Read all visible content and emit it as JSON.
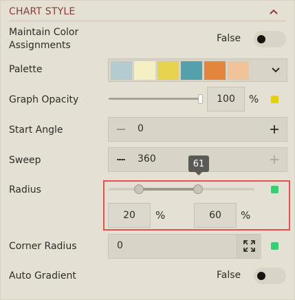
{
  "header": {
    "title": "CHART STYLE",
    "collapse_icon": "chevron-up-icon"
  },
  "maintain_colors": {
    "label": "Maintain Color Assignments",
    "label_line1": "Maintain Color",
    "label_line2": "Assignments",
    "value_text": "False",
    "checked": false
  },
  "palette": {
    "label": "Palette",
    "swatches": [
      "#b4cbd0",
      "#f5efc4",
      "#e7d34d",
      "#55a0ad",
      "#e3853d",
      "#f1c39a"
    ],
    "dropdown_icon": "chevron-down-icon"
  },
  "graph_opacity": {
    "label": "Graph Opacity",
    "value": "100",
    "unit": "%",
    "slider_fraction": 1.0,
    "color": "#e6cf0f"
  },
  "start_angle": {
    "label": "Start Angle",
    "value": "0",
    "minus_icon": "minus-icon",
    "plus_icon": "plus-icon"
  },
  "sweep": {
    "label": "Sweep",
    "value": "360",
    "minus_icon": "minus-icon",
    "plus_icon": "plus-icon"
  },
  "radius": {
    "label": "Radius",
    "tooltip": "61",
    "min_value": "20",
    "max_value": "60",
    "unit": "%",
    "color": "#3ecb73"
  },
  "corner_radius": {
    "label": "Corner Radius",
    "value": "0",
    "expand_icon": "expand-icon",
    "color": "#3ecb73"
  },
  "auto_gradient": {
    "label": "Auto Gradient",
    "value_text": "False",
    "checked": false
  }
}
